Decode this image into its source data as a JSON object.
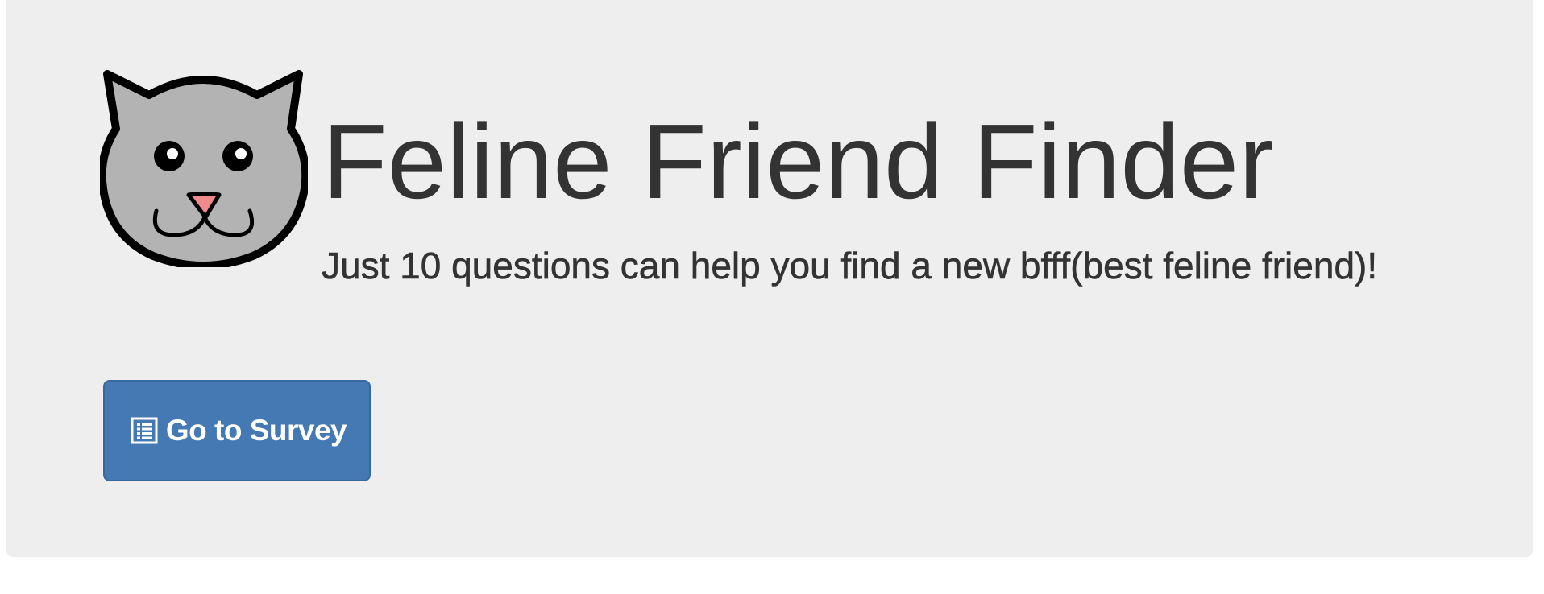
{
  "hero": {
    "logo_icon": "cat-face-icon",
    "title": "Feline Friend Finder",
    "tagline": "Just 10 questions can help you find a new bfff(best feline friend)!",
    "survey_button": {
      "icon": "list-alt-icon",
      "label": "Go to Survey"
    }
  },
  "colors": {
    "background": "#eeeeee",
    "text": "#333333",
    "button": "#4479b3",
    "cat_fur": "#b3b3b3",
    "cat_nose": "#f08a8a"
  }
}
